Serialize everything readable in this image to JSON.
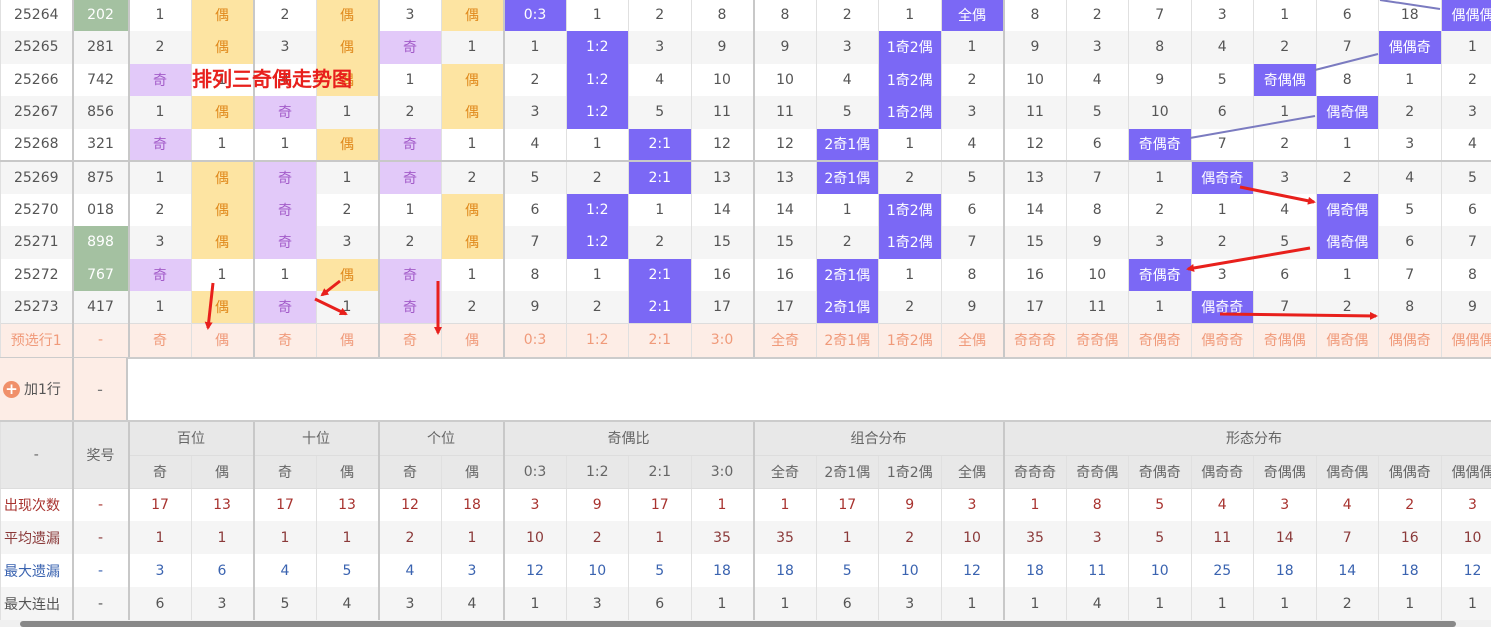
{
  "title_overlay": "排列三奇偶走势图",
  "rows": [
    {
      "issue": "25264",
      "num": "202",
      "num_highlight": true,
      "cells": [
        "1",
        "偶",
        "2",
        "偶",
        "3",
        "偶",
        "0:3",
        "1",
        "2",
        "8",
        "8",
        "2",
        "1",
        "全偶",
        "8",
        "2",
        "7",
        "3",
        "1",
        "6",
        "18",
        "偶偶偶"
      ]
    },
    {
      "issue": "25265",
      "num": "281",
      "num_highlight": false,
      "cells": [
        "2",
        "偶",
        "3",
        "偶",
        "奇",
        "1",
        "1",
        "1:2",
        "3",
        "9",
        "9",
        "3",
        "1奇2偶",
        "1",
        "9",
        "3",
        "8",
        "4",
        "2",
        "7",
        "偶偶奇",
        "1"
      ]
    },
    {
      "issue": "25266",
      "num": "742",
      "num_highlight": false,
      "cells": [
        "奇",
        "1",
        "4",
        "偶",
        "1",
        "偶",
        "2",
        "1:2",
        "4",
        "10",
        "10",
        "4",
        "1奇2偶",
        "2",
        "10",
        "4",
        "9",
        "5",
        "奇偶偶",
        "8",
        "1",
        "2"
      ]
    },
    {
      "issue": "25267",
      "num": "856",
      "num_highlight": false,
      "cells": [
        "1",
        "偶",
        "奇",
        "1",
        "2",
        "偶",
        "3",
        "1:2",
        "5",
        "11",
        "11",
        "5",
        "1奇2偶",
        "3",
        "11",
        "5",
        "10",
        "6",
        "1",
        "偶奇偶",
        "2",
        "3"
      ]
    },
    {
      "issue": "25268",
      "num": "321",
      "num_highlight": false,
      "cells": [
        "奇",
        "1",
        "1",
        "偶",
        "奇",
        "1",
        "4",
        "1",
        "2:1",
        "12",
        "12",
        "2奇1偶",
        "1",
        "4",
        "12",
        "6",
        "奇偶奇",
        "7",
        "2",
        "1",
        "3",
        "4"
      ]
    },
    {
      "issue": "25269",
      "num": "875",
      "num_highlight": false,
      "cells": [
        "1",
        "偶",
        "奇",
        "1",
        "奇",
        "2",
        "5",
        "2",
        "2:1",
        "13",
        "13",
        "2奇1偶",
        "2",
        "5",
        "13",
        "7",
        "1",
        "偶奇奇",
        "3",
        "2",
        "4",
        "5"
      ]
    },
    {
      "issue": "25270",
      "num": "018",
      "num_highlight": false,
      "cells": [
        "2",
        "偶",
        "奇",
        "2",
        "1",
        "偶",
        "6",
        "1:2",
        "1",
        "14",
        "14",
        "1",
        "1奇2偶",
        "6",
        "14",
        "8",
        "2",
        "1",
        "4",
        "偶奇偶",
        "5",
        "6"
      ]
    },
    {
      "issue": "25271",
      "num": "898",
      "num_highlight": true,
      "cells": [
        "3",
        "偶",
        "奇",
        "3",
        "2",
        "偶",
        "7",
        "1:2",
        "2",
        "15",
        "15",
        "2",
        "1奇2偶",
        "7",
        "15",
        "9",
        "3",
        "2",
        "5",
        "偶奇偶",
        "6",
        "7"
      ]
    },
    {
      "issue": "25272",
      "num": "767",
      "num_highlight": true,
      "cells": [
        "奇",
        "1",
        "1",
        "偶",
        "奇",
        "1",
        "8",
        "1",
        "2:1",
        "16",
        "16",
        "2奇1偶",
        "1",
        "8",
        "16",
        "10",
        "奇偶奇",
        "3",
        "6",
        "1",
        "7",
        "8"
      ]
    },
    {
      "issue": "25273",
      "num": "417",
      "num_highlight": false,
      "cells": [
        "1",
        "偶",
        "奇",
        "1",
        "奇",
        "2",
        "9",
        "2",
        "2:1",
        "17",
        "17",
        "2奇1偶",
        "2",
        "9",
        "17",
        "11",
        "1",
        "偶奇奇",
        "7",
        "2",
        "8",
        "9"
      ]
    }
  ],
  "preselect": {
    "label": "预选行1",
    "num": "-",
    "cells": [
      "奇",
      "偶",
      "奇",
      "偶",
      "奇",
      "偶",
      "0:3",
      "1:2",
      "2:1",
      "3:0",
      "全奇",
      "2奇1偶",
      "1奇2偶",
      "全偶",
      "奇奇奇",
      "奇奇偶",
      "奇偶奇",
      "偶奇奇",
      "奇偶偶",
      "偶奇偶",
      "偶偶奇",
      "偶偶偶"
    ]
  },
  "add_row": {
    "label": "加1行",
    "num": "-"
  },
  "header": {
    "corner": "-",
    "num_label": "奖号",
    "groups": [
      {
        "label": "百位",
        "span": 2
      },
      {
        "label": "十位",
        "span": 2
      },
      {
        "label": "个位",
        "span": 2
      },
      {
        "label": "奇偶比",
        "span": 4
      },
      {
        "label": "组合分布",
        "span": 4
      },
      {
        "label": "形态分布",
        "span": 8
      }
    ],
    "sub": [
      "奇",
      "偶",
      "奇",
      "偶",
      "奇",
      "偶",
      "0:3",
      "1:2",
      "2:1",
      "3:0",
      "全奇",
      "2奇1偶",
      "1奇2偶",
      "全偶",
      "奇奇奇",
      "奇奇偶",
      "奇偶奇",
      "偶奇奇",
      "奇偶偶",
      "偶奇偶",
      "偶偶奇",
      "偶偶偶"
    ]
  },
  "stats": [
    {
      "label": "出现次数",
      "num": "-",
      "values": [
        "17",
        "13",
        "17",
        "13",
        "12",
        "18",
        "3",
        "9",
        "17",
        "1",
        "1",
        "17",
        "9",
        "3",
        "1",
        "8",
        "5",
        "4",
        "3",
        "4",
        "2",
        "3"
      ]
    },
    {
      "label": "平均遗漏",
      "num": "-",
      "values": [
        "1",
        "1",
        "1",
        "1",
        "2",
        "1",
        "10",
        "2",
        "1",
        "35",
        "35",
        "1",
        "2",
        "10",
        "35",
        "3",
        "5",
        "11",
        "14",
        "7",
        "16",
        "10"
      ]
    },
    {
      "label": "最大遗漏",
      "num": "-",
      "values": [
        "3",
        "6",
        "4",
        "5",
        "4",
        "3",
        "12",
        "10",
        "5",
        "18",
        "18",
        "5",
        "10",
        "12",
        "18",
        "11",
        "10",
        "25",
        "18",
        "14",
        "18",
        "12"
      ]
    },
    {
      "label": "最大连出",
      "num": "-",
      "values": [
        "6",
        "3",
        "5",
        "4",
        "3",
        "4",
        "1",
        "3",
        "6",
        "1",
        "1",
        "6",
        "3",
        "1",
        "1",
        "4",
        "1",
        "1",
        "1",
        "2",
        "1",
        "1"
      ]
    }
  ],
  "colors": {
    "odd_bg": "#e2c9f9",
    "even_bg": "#fde4a2",
    "hit_bg": "#7b68f5",
    "num_hl_bg": "#a4c1a1",
    "preselect_bg": "#fdede6",
    "annotation_red": "#e8201c",
    "trend_line": "#7b7bc0"
  }
}
